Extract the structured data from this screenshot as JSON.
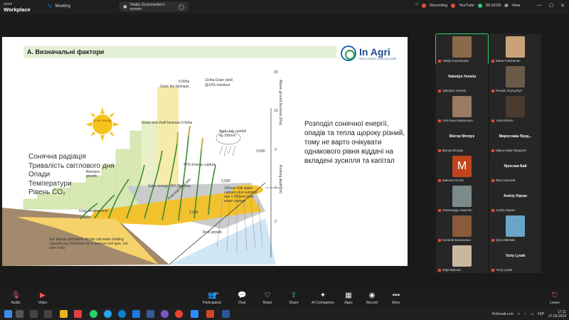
{
  "app": {
    "brand_top": "zoom",
    "brand_bottom": "Workplace",
    "meeting_label": "Meeting",
    "screen_label": "Vitaliy Gryschenko's screen"
  },
  "status": {
    "recording": "Recording",
    "youtube": "YouTube",
    "timer": "00:18:59",
    "view_label": "View"
  },
  "slide": {
    "title": "А. Визначальні фактори",
    "logo_text": "In Agri",
    "logo_sub": "INTELLIGENT AGRICULTURE",
    "factors": [
      "Сонячна радіація",
      "Тривалість світлового дня",
      "Опади",
      "Температури",
      "Рівень CO₂"
    ],
    "paragraph": "Розподіл сонячної енергії, опадів та тепла щороку різний, тому не варто очікувати однакового рівня віддачі на вкладені зусилля та капітал",
    "sun_label": "Solar energy",
    "labels": {
      "yield_a": "9.5t/ha",
      "yield_b": "Grain dry biomass",
      "yield_c": "11t/ha Grain yield",
      "yield_d": "@15% moisture",
      "straw": "Straw and chaff biomass 9.5t/ha",
      "rain": "April–July rainfall eg 200mm",
      "energy": "47% Energy capture",
      "solar": "Solar energy: 267.2ha/year",
      "biomass": "Biomass growth",
      "crop": "Crop development",
      "soil_water": "150mm Soil water capture plus summer rain = 350mm total water capture",
      "soil_text": "Soil texture and depth dictate soil water holding capacity (eg 150mm/m for a medium soil type, not over rock)",
      "root": "Root growth",
      "potential": "Potential PC 3,000",
      "axis_top": "Above ground biomass (t/ha)",
      "axis_bottom": "Rooting depth (m)",
      "tick_20": "20",
      "tick_10": "10",
      "tick_0": "0",
      "tick_1": "1",
      "tick_2": "2",
      "v3000": "3,000",
      "v2000": "2,000",
      "v1000": "1,000"
    }
  },
  "participants": [
    {
      "display": "",
      "caption": "Vitaliy Gryschenko",
      "avatar_color": "#8a6a4a",
      "active": true
    },
    {
      "display": "",
      "caption": "Maria Fokchenko",
      "avatar_color": "#c9a27a"
    },
    {
      "display": "Valentyn.Yemets",
      "caption": "Valentyn.Yemets"
    },
    {
      "display": "",
      "caption": "Roman Grynyshyn",
      "avatar_color": "#6b5a4a"
    },
    {
      "display": "",
      "caption": "Світлана Мойсеєнко",
      "avatar_color": "#9a7b63"
    },
    {
      "display": "",
      "caption": "Yulia Klimko",
      "avatar_color": "#4a3a30"
    },
    {
      "display": "Віктор Мотрук",
      "caption": "Віктор Мотрук"
    },
    {
      "display": "Мирослава Пред...",
      "caption": "Мирослава Предоля"
    },
    {
      "display": "",
      "caption": "Микола Остан",
      "avatar_color": "#c0451f",
      "letter": "M"
    },
    {
      "display": "Ярослав Бай",
      "caption": "Ярослав Бай"
    },
    {
      "display": "",
      "caption": "Олександр Аверчен",
      "avatar_color": "#7b8a8a"
    },
    {
      "display": "Andriy Kipran",
      "caption": "Andriy Kipran"
    },
    {
      "display": "",
      "caption": "Наталія Басиленко",
      "avatar_color": "#8a5a3a"
    },
    {
      "display": "",
      "caption": "lryna-Mitchak",
      "avatar_color": "#6aa5c8"
    },
    {
      "display": "",
      "caption": "Olga Bykova",
      "avatar_color": "#c9b8a0"
    },
    {
      "display": "Yuriy Lysak",
      "caption": "Yuriy Lysak"
    }
  ],
  "controls": {
    "audio": "Audio",
    "video": "Video",
    "participants": "Participants",
    "participants_count": "16",
    "chat": "Chat",
    "react": "React",
    "share": "Share",
    "ai": "AI Companion",
    "apps": "Apps",
    "record": "Record",
    "more": "More",
    "leave": "Leave"
  },
  "taskbar": {
    "desktop_label": "Робочий стіл",
    "lang": "УКР",
    "time": "17:11",
    "date": "27.09.2024"
  },
  "colors": {
    "accent_green": "#2ecc71",
    "leave_red": "#ff5a5a",
    "logo_blue": "#1f4c8f"
  }
}
